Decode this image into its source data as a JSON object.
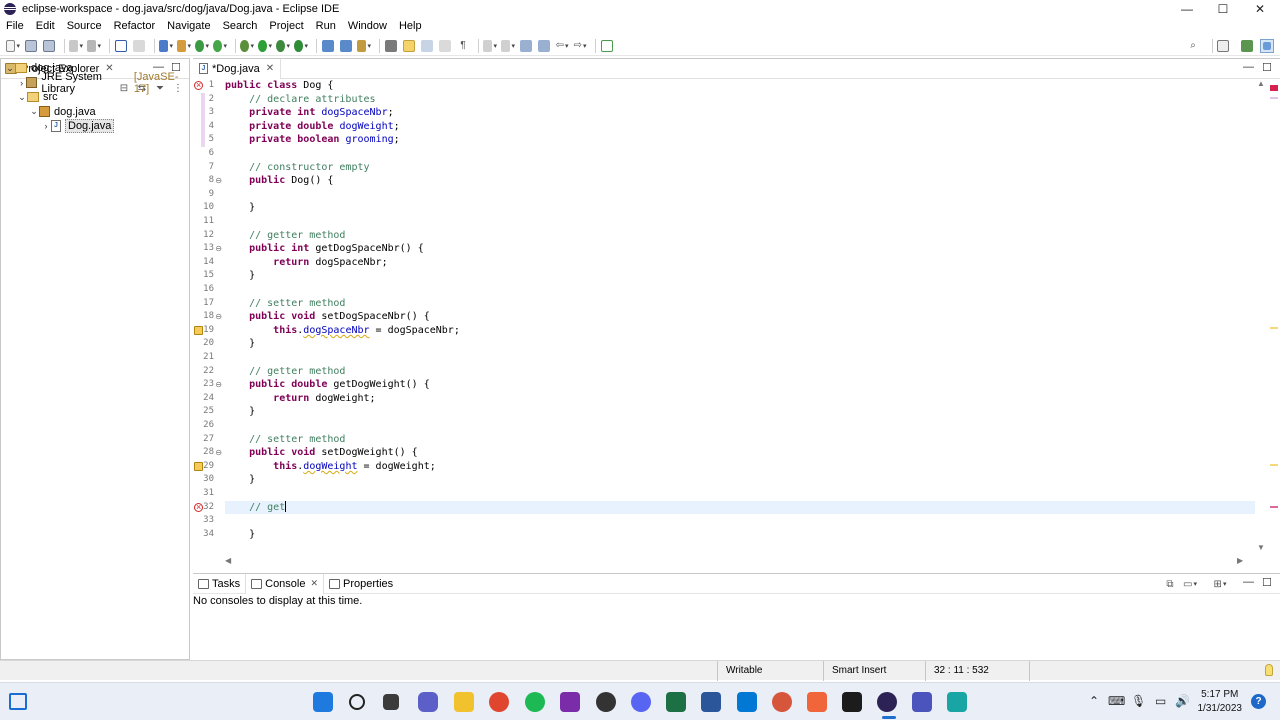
{
  "window": {
    "title": "eclipse-workspace - dog.java/src/dog/java/Dog.java - Eclipse IDE",
    "minimize": "—",
    "maximize": "☐",
    "close": "✕"
  },
  "menu": [
    "File",
    "Edit",
    "Source",
    "Refactor",
    "Navigate",
    "Search",
    "Project",
    "Run",
    "Window",
    "Help"
  ],
  "explorer": {
    "title": "Project Explorer",
    "close_glyph": "✕",
    "tree": [
      {
        "label": "dog.java",
        "icon": "project-icon",
        "expanded": "open",
        "depth": 0
      },
      {
        "label": "JRE System Library",
        "suffix": "[JavaSE-17]",
        "icon": "library-icon",
        "expanded": "closed",
        "depth": 1
      },
      {
        "label": "src",
        "icon": "source-folder-icon",
        "expanded": "open",
        "depth": 1
      },
      {
        "label": "dog.java",
        "icon": "package-icon",
        "expanded": "open",
        "depth": 2
      },
      {
        "label": "Dog.java",
        "icon": "java-file-icon",
        "expanded": "closed",
        "depth": 3,
        "selected": true
      }
    ]
  },
  "editor": {
    "tab_label": "*Dog.java",
    "tab_close": "✕",
    "lines": [
      {
        "n": "1",
        "text": "public class Dog {"
      },
      {
        "n": "2",
        "text": "    // declare attributes"
      },
      {
        "n": "3",
        "text": "    private int dogSpaceNbr;"
      },
      {
        "n": "4",
        "text": "    private double dogWeight;"
      },
      {
        "n": "5",
        "text": "    private boolean grooming;"
      },
      {
        "n": "6",
        "text": ""
      },
      {
        "n": "7",
        "text": "    // constructor empty"
      },
      {
        "n": "8",
        "text": "    public Dog() {"
      },
      {
        "n": "9",
        "text": ""
      },
      {
        "n": "10",
        "text": "    }"
      },
      {
        "n": "11",
        "text": ""
      },
      {
        "n": "12",
        "text": "    // getter method"
      },
      {
        "n": "13",
        "text": "    public int getDogSpaceNbr() {"
      },
      {
        "n": "14",
        "text": "        return dogSpaceNbr;"
      },
      {
        "n": "15",
        "text": "    }"
      },
      {
        "n": "16",
        "text": ""
      },
      {
        "n": "17",
        "text": "    // setter method"
      },
      {
        "n": "18",
        "text": "    public void setDogSpaceNbr() {"
      },
      {
        "n": "19",
        "text": "        this.dogSpaceNbr = dogSpaceNbr;"
      },
      {
        "n": "20",
        "text": "    }"
      },
      {
        "n": "21",
        "text": ""
      },
      {
        "n": "22",
        "text": "    // getter method"
      },
      {
        "n": "23",
        "text": "    public double getDogWeight() {"
      },
      {
        "n": "24",
        "text": "        return dogWeight;"
      },
      {
        "n": "25",
        "text": "    }"
      },
      {
        "n": "26",
        "text": ""
      },
      {
        "n": "27",
        "text": "    // setter method"
      },
      {
        "n": "28",
        "text": "    public void setDogWeight() {"
      },
      {
        "n": "29",
        "text": "        this.dogWeight = dogWeight;"
      },
      {
        "n": "30",
        "text": "    }"
      },
      {
        "n": "31",
        "text": ""
      },
      {
        "n": "32",
        "text": "    // get"
      },
      {
        "n": "33",
        "text": ""
      },
      {
        "n": "34",
        "text": "    }"
      }
    ],
    "fold_lines": [
      "8",
      "13",
      "18",
      "23",
      "28"
    ],
    "warning_lines": [
      "19",
      "29"
    ],
    "error_lines": [
      "1",
      "32"
    ],
    "current_line": "32"
  },
  "bottom_panel": {
    "tabs": [
      {
        "label": "Tasks",
        "active": false
      },
      {
        "label": "Console",
        "active": true
      },
      {
        "label": "Properties",
        "active": false
      }
    ],
    "message": "No consoles to display at this time."
  },
  "status": {
    "mode": "Writable",
    "insert": "Smart Insert",
    "position": "32 : 11 : 532"
  },
  "taskbar": {
    "time": "5:17 PM",
    "date": "1/31/2023",
    "help": "?"
  },
  "colors": {
    "keyword": "#7f0055",
    "comment": "#3f7f5f",
    "field": "#0000c0",
    "current_line": "#e8f2fe"
  }
}
